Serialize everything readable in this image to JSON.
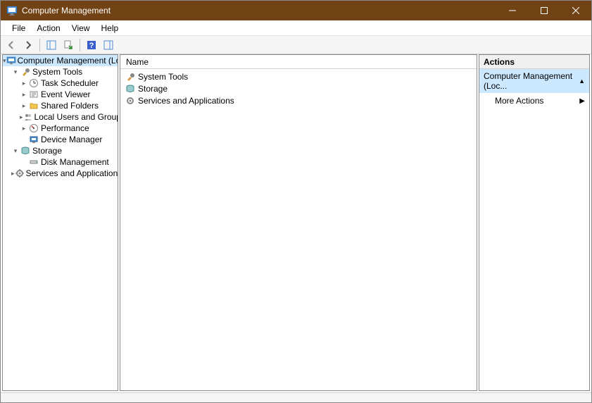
{
  "title": "Computer Management",
  "menu": {
    "file": "File",
    "action": "Action",
    "view": "View",
    "help": "Help"
  },
  "tree": {
    "root": "Computer Management (Local)",
    "system_tools": "System Tools",
    "task_scheduler": "Task Scheduler",
    "event_viewer": "Event Viewer",
    "shared_folders": "Shared Folders",
    "local_users": "Local Users and Groups",
    "performance": "Performance",
    "device_manager": "Device Manager",
    "storage": "Storage",
    "disk_management": "Disk Management",
    "services_apps": "Services and Applications"
  },
  "list": {
    "header_name": "Name",
    "rows": {
      "system_tools": "System Tools",
      "storage": "Storage",
      "services_apps": "Services and Applications"
    }
  },
  "actions": {
    "header": "Actions",
    "context": "Computer Management (Loc...",
    "more": "More Actions"
  }
}
